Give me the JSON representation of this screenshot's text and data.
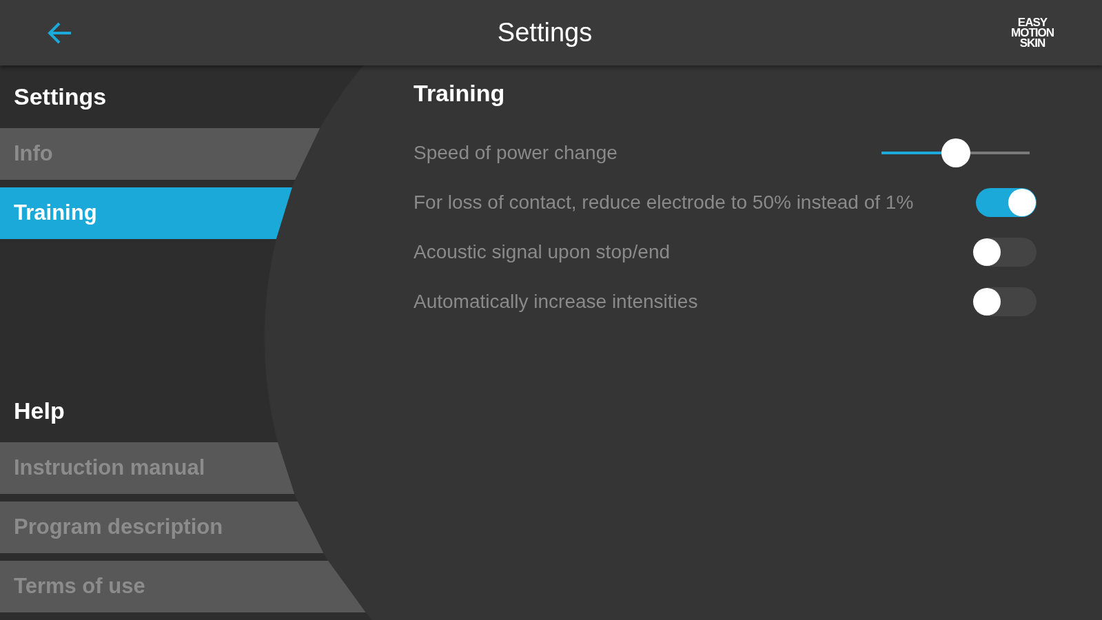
{
  "header": {
    "title": "Settings",
    "logo": [
      "EASY",
      "MOTION",
      "SKIN"
    ]
  },
  "sidebar": {
    "groups": [
      {
        "heading": "Settings",
        "items": [
          {
            "label": "Info",
            "selected": false
          },
          {
            "label": "Training",
            "selected": true
          }
        ]
      },
      {
        "heading": "Help",
        "items": [
          {
            "label": "Instruction manual",
            "selected": false
          },
          {
            "label": "Program description",
            "selected": false
          },
          {
            "label": "Terms of use",
            "selected": false
          }
        ]
      }
    ]
  },
  "content": {
    "heading": "Training",
    "settings": [
      {
        "kind": "slider",
        "label": "Speed of power change",
        "level": 0.5
      },
      {
        "kind": "toggle",
        "label": "For loss of contact, reduce electrode to 50% instead of 1%",
        "on": true
      },
      {
        "kind": "toggle",
        "label": "Acoustic signal upon stop/end",
        "on": false
      },
      {
        "kind": "toggle",
        "label": "Automatically increase intensities",
        "on": false
      }
    ]
  }
}
